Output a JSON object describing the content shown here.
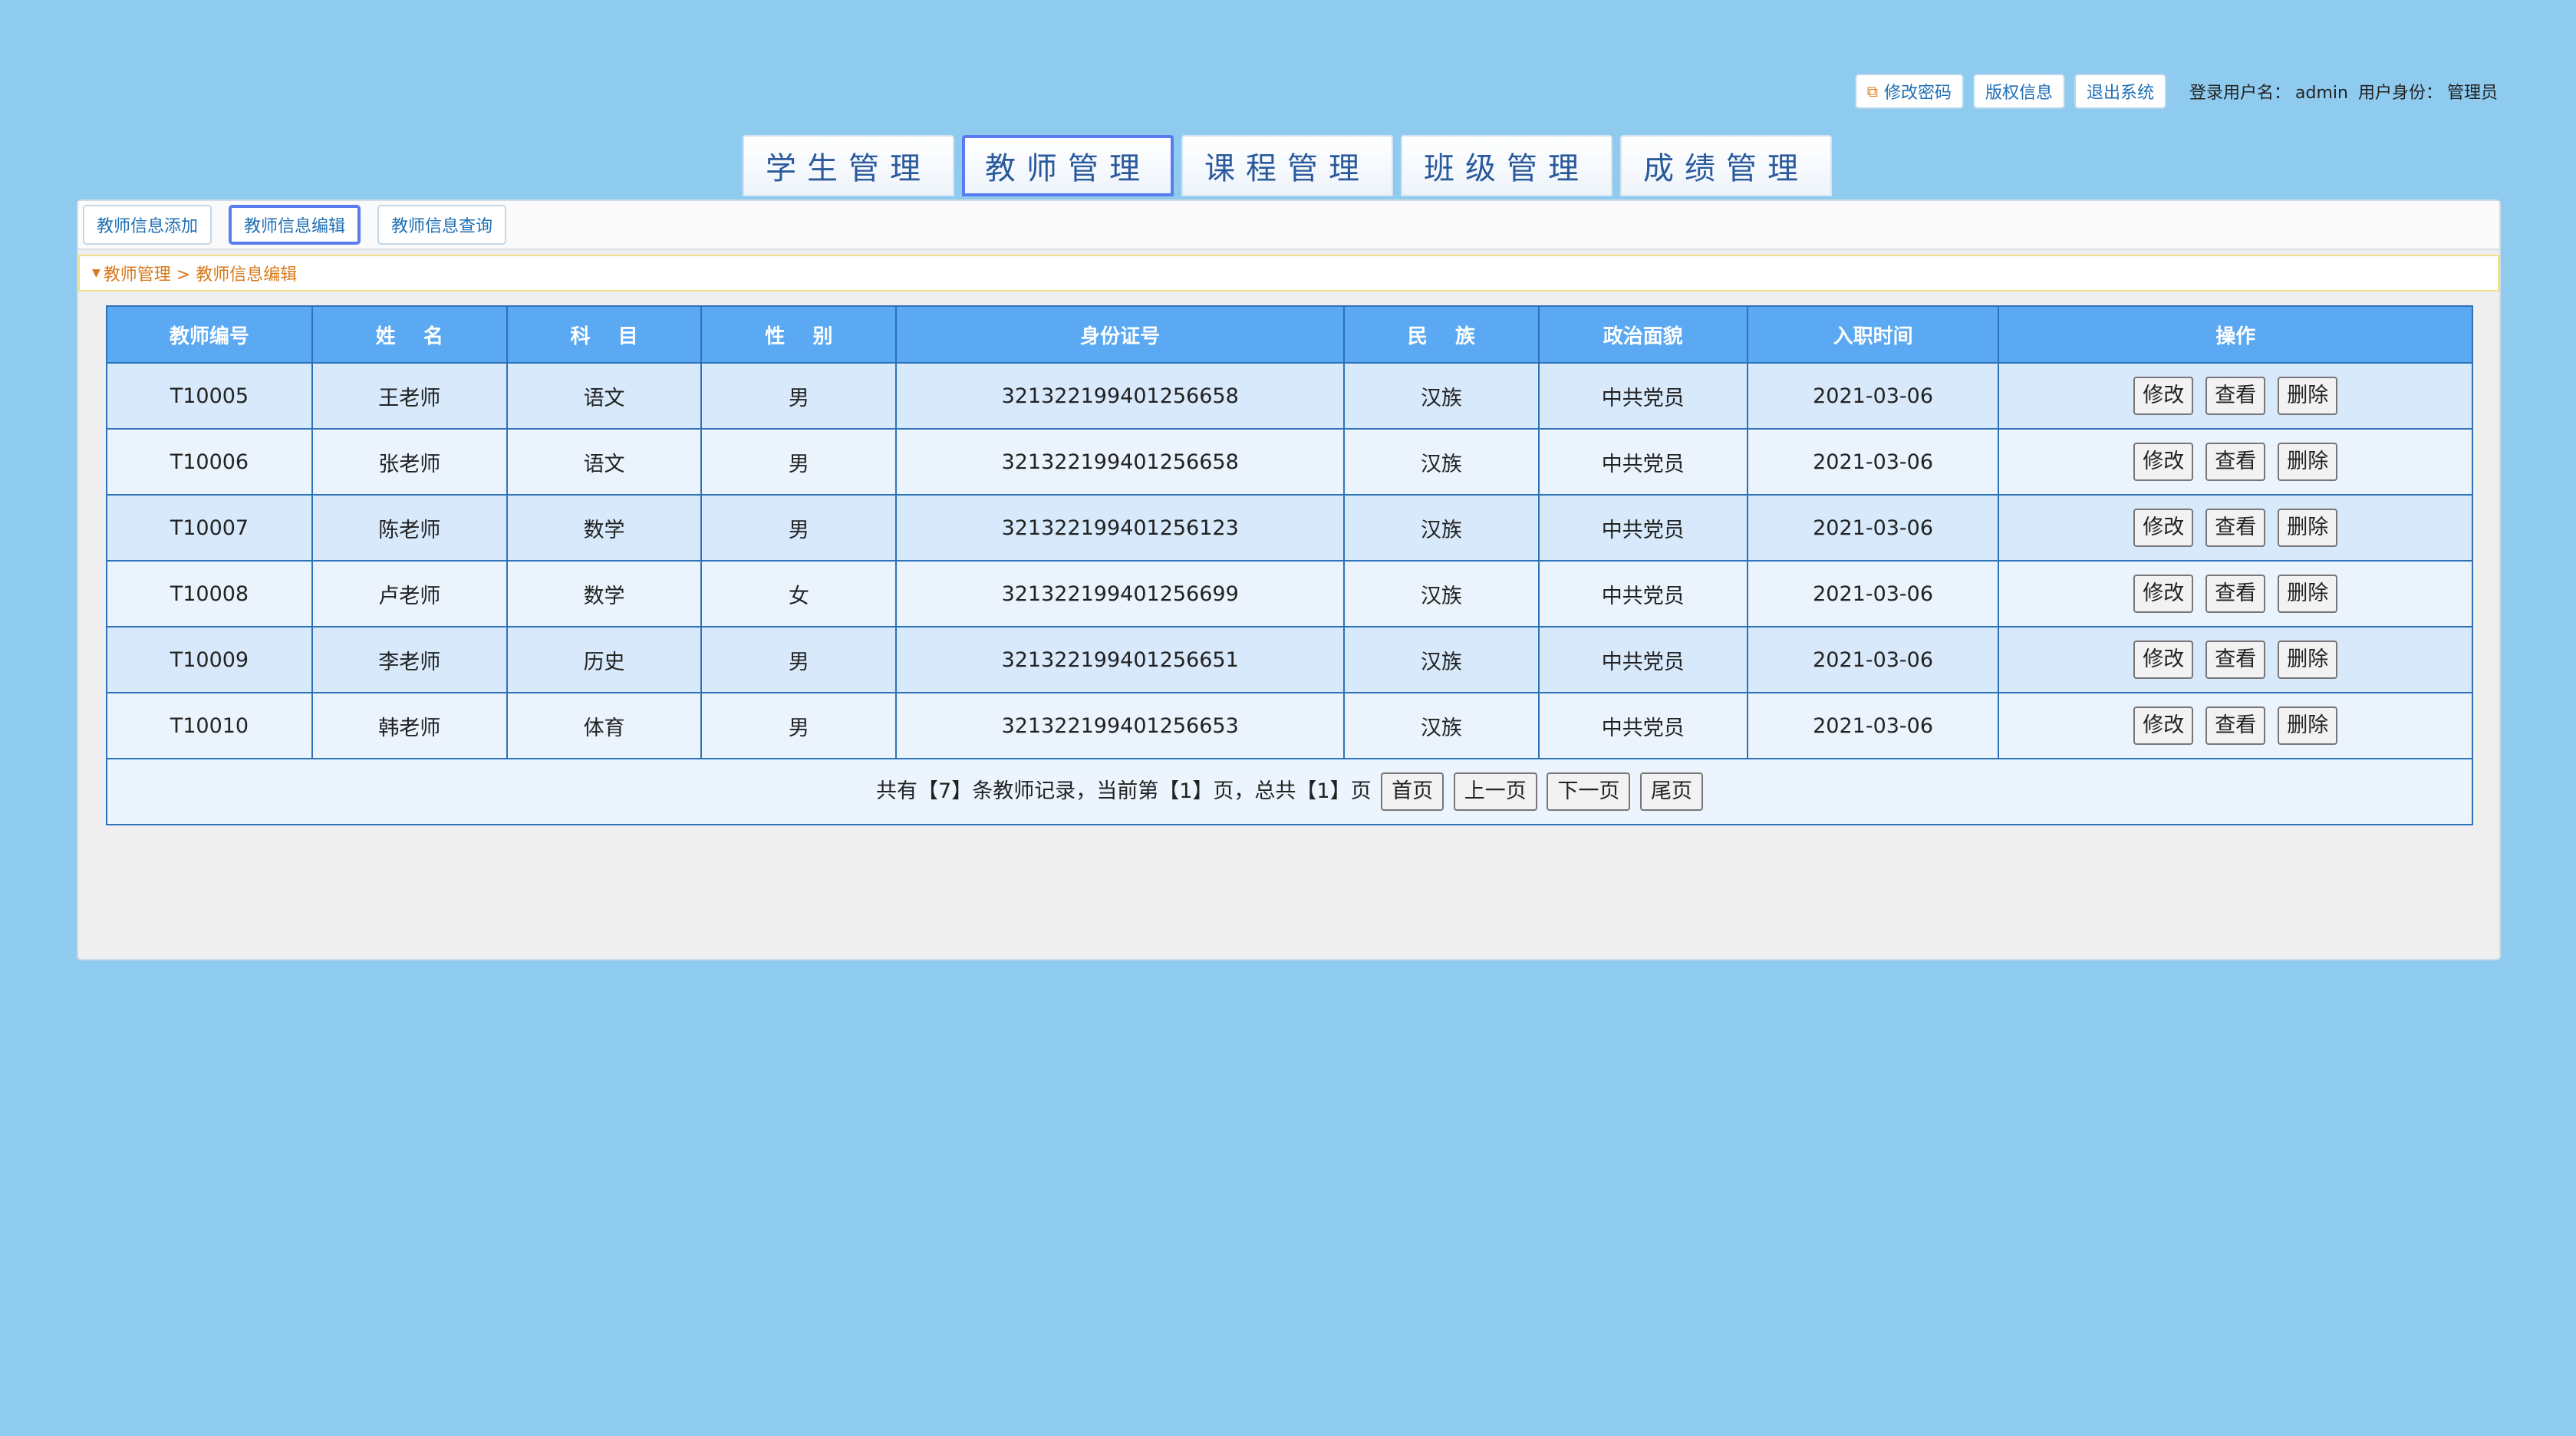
{
  "topbar": {
    "change_password": "修改密码",
    "copyright": "版权信息",
    "logout": "退出系统",
    "login_user_label": "登录用户名：",
    "login_user": "admin",
    "role_label": "用户身份：",
    "role": "管理员"
  },
  "main_tabs": [
    {
      "label": "学生管理"
    },
    {
      "label": "教师管理"
    },
    {
      "label": "课程管理"
    },
    {
      "label": "班级管理"
    },
    {
      "label": "成绩管理"
    }
  ],
  "sub_nav": [
    {
      "label": "教师信息添加"
    },
    {
      "label": "教师信息编辑"
    },
    {
      "label": "教师信息查询"
    }
  ],
  "breadcrumb": "教师管理 > 教师信息编辑",
  "table": {
    "headers": [
      "教师编号",
      "姓    名",
      "科    目",
      "性    别",
      "身份证号",
      "民    族",
      "政治面貌",
      "入职时间",
      "操作"
    ],
    "rows": [
      [
        "T10005",
        "王老师",
        "语文",
        "男",
        "321322199401256658",
        "汉族",
        "中共党员",
        "2021-03-06"
      ],
      [
        "T10006",
        "张老师",
        "语文",
        "男",
        "321322199401256658",
        "汉族",
        "中共党员",
        "2021-03-06"
      ],
      [
        "T10007",
        "陈老师",
        "数学",
        "男",
        "321322199401256123",
        "汉族",
        "中共党员",
        "2021-03-06"
      ],
      [
        "T10008",
        "卢老师",
        "数学",
        "女",
        "321322199401256699",
        "汉族",
        "中共党员",
        "2021-03-06"
      ],
      [
        "T10009",
        "李老师",
        "历史",
        "男",
        "321322199401256651",
        "汉族",
        "中共党员",
        "2021-03-06"
      ],
      [
        "T10010",
        "韩老师",
        "体育",
        "男",
        "321322199401256653",
        "汉族",
        "中共党员",
        "2021-03-06"
      ]
    ],
    "actions": {
      "edit": "修改",
      "view": "查看",
      "delete": "删除"
    }
  },
  "pager": {
    "summary": "共有【7】条教师记录，当前第【1】页，总共【1】页",
    "first": "首页",
    "prev": "上一页",
    "next": "下一页",
    "last": "尾页"
  },
  "colors": {
    "background": "#8ecbef",
    "header": "#5aa9f2",
    "accent": "#d87a1c"
  },
  "icons": {
    "change_password": "external-link-icon"
  }
}
